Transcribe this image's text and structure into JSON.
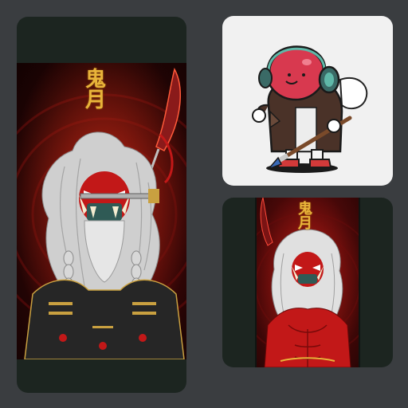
{
  "cards": {
    "left": {
      "title_glyphs": [
        "鬼",
        "月"
      ]
    },
    "top_right": {
      "icon": "mascot-sticker"
    },
    "bottom_right": {
      "title_glyphs": [
        "鬼",
        "月"
      ]
    }
  },
  "colors": {
    "background": "#3a3d40",
    "card_dark": "#1c2520",
    "card_light": "#f1f1f1",
    "accent_red": "#c21818",
    "accent_gold": "#e8b43a"
  }
}
